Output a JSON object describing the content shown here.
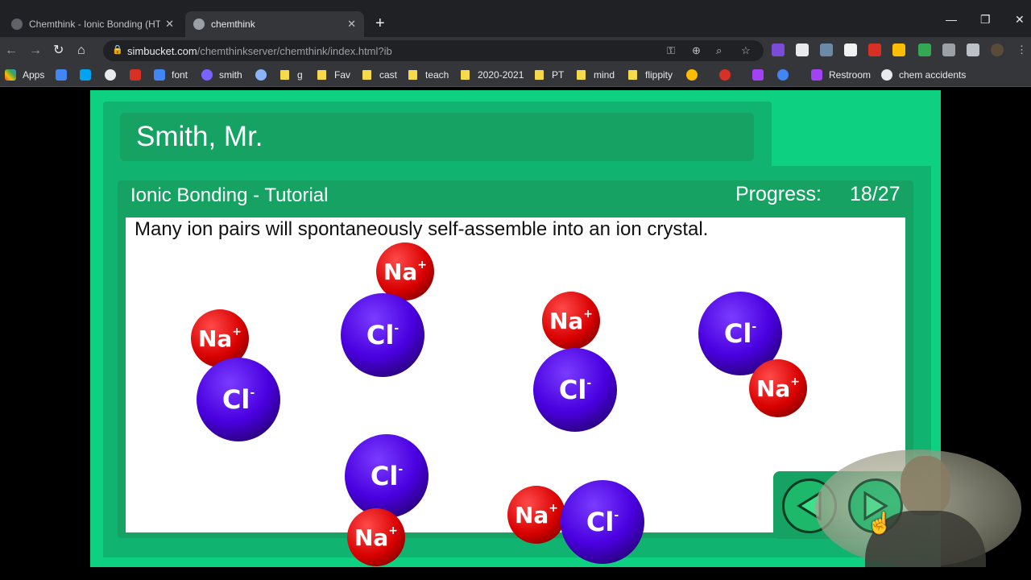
{
  "browser": {
    "tabs": [
      {
        "title": "Chemthink - Ionic Bonding (HTM",
        "active": false
      },
      {
        "title": "chemthink",
        "active": true
      }
    ],
    "url_host": "simbucket.com",
    "url_path": "/chemthinkserver/chemthink/index.html?ib",
    "bookmarks": [
      {
        "label": "Apps",
        "icon": "apps-grid-icon"
      },
      {
        "label": "font",
        "icon": "docs-icon"
      },
      {
        "label": "smith",
        "icon": "zoom-icon"
      },
      {
        "label": "g",
        "icon": "folder-icon"
      },
      {
        "label": "Fav",
        "icon": "folder-icon"
      },
      {
        "label": "cast",
        "icon": "folder-icon"
      },
      {
        "label": "teach",
        "icon": "folder-icon"
      },
      {
        "label": "2020-2021",
        "icon": "folder-icon"
      },
      {
        "label": "PT",
        "icon": "folder-icon"
      },
      {
        "label": "mind",
        "icon": "folder-icon"
      },
      {
        "label": "flippity",
        "icon": "folder-icon"
      },
      {
        "label": "Restroom",
        "icon": "list-icon"
      },
      {
        "label": "chem accidents",
        "icon": "globe-icon"
      }
    ]
  },
  "app": {
    "user_name": "Smith, Mr.",
    "tutorial_title": "Ionic Bonding - Tutorial",
    "progress_label": "Progress:",
    "progress_value": "18/27",
    "instruction": "Many ion pairs will spontaneously self-assemble into an ion crystal.",
    "ions": {
      "na_symbol": "Na",
      "na_charge": "+",
      "cl_symbol": "Cl",
      "cl_charge": "-"
    }
  },
  "colors": {
    "app_bg": "#0ed081",
    "panel": "#10b470",
    "panel_dark": "#16a263",
    "sodium": "#d80000",
    "chlorine": "#4a00e0"
  }
}
